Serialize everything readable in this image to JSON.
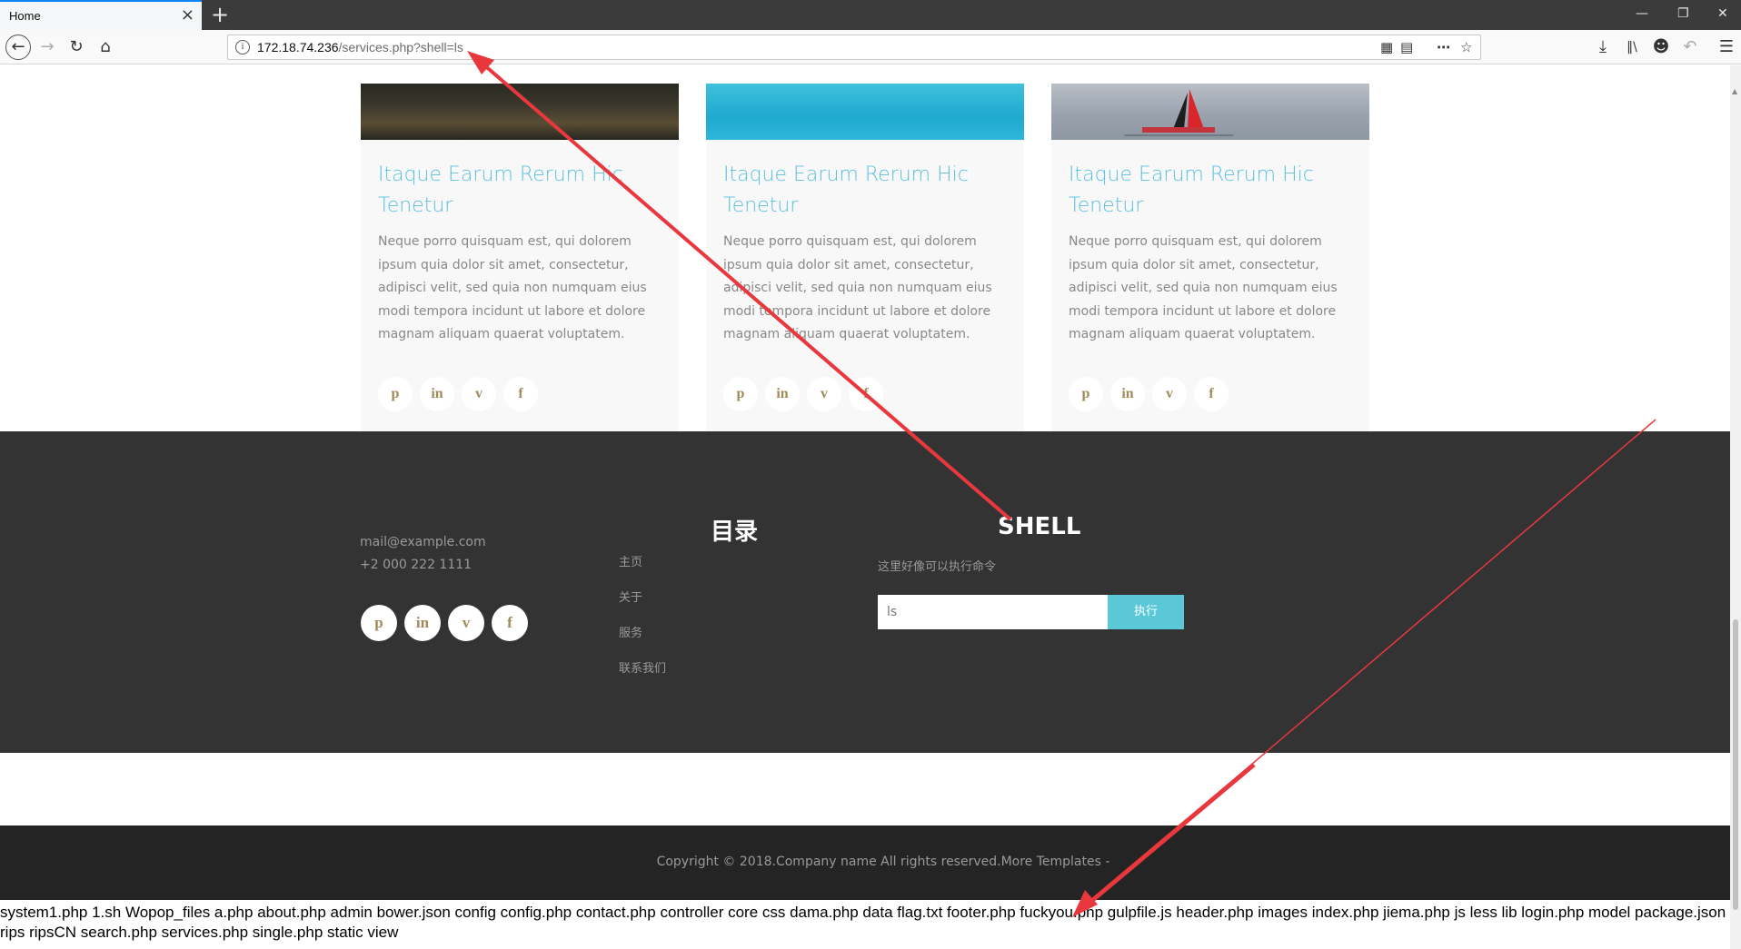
{
  "browser": {
    "tab_title": "Home",
    "tab_close": "×",
    "new_tab": "+",
    "min": "—",
    "restore": "❐",
    "close": "✕",
    "url_host": "172.18.74.236",
    "url_path": "/services.php?shell=ls"
  },
  "cards": [
    {
      "title": "Itaque Earum Rerum Hic Tenetur",
      "text": "Neque porro quisquam est, qui dolorem ipsum quia dolor sit amet, consectetur, adipisci velit, sed quia non numquam eius modi tempora incidunt ut labore et dolore magnam aliquam quaerat voluptatem."
    },
    {
      "title": "Itaque Earum Rerum Hic Tenetur",
      "text": "Neque porro quisquam est, qui dolorem ipsum quia dolor sit amet, consectetur, adipisci velit, sed quia non numquam eius modi tempora incidunt ut labore et dolore magnam aliquam quaerat voluptatem."
    },
    {
      "title": "Itaque Earum Rerum Hic Tenetur",
      "text": "Neque porro quisquam est, qui dolorem ipsum quia dolor sit amet, consectetur, adipisci velit, sed quia non numquam eius modi tempora incidunt ut labore et dolore magnam aliquam quaerat voluptatem."
    }
  ],
  "social_icons": [
    "pinterest-icon",
    "linkedin-icon",
    "vimeo-icon",
    "facebook-icon"
  ],
  "social_glyphs": {
    "pinterest": "p",
    "linkedin": "in",
    "vimeo": "v",
    "facebook": "f"
  },
  "footer": {
    "email": "mail@example.com",
    "phone": "+2 000 222 1111",
    "menu_heading": "目录",
    "menu_items": [
      "主页",
      "关于",
      "服务",
      "联系我们"
    ],
    "shell_heading": "SHELL",
    "shell_note": "这里好像可以执行命令",
    "shell_input_value": "ls",
    "shell_button": "执行"
  },
  "copyright": "Copyright © 2018.Company name All rights reserved.More Templates -",
  "output_text": "system1.php 1.sh Wopop_files a.php about.php admin bower.json config config.php contact.php controller core css dama.php data flag.txt footer.php fuckyou.php gulpfile.js header.php images index.php jiema.php js less lib login.php model package.json rips ripsCN search.php services.php single.php static view",
  "colors": {
    "accent": "#5bc0de",
    "button": "#5bc8d8",
    "footer_bg": "#333333",
    "copyright_bg": "#242424",
    "annotation_arrow": "#e8383d"
  }
}
